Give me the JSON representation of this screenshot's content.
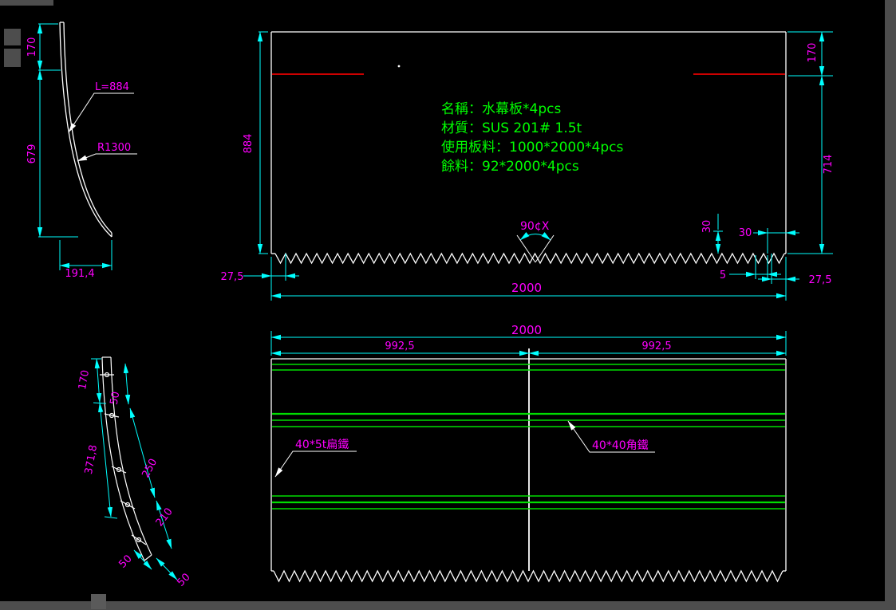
{
  "app": {
    "background": "#000000",
    "chrome_color": "#4d4d4d"
  },
  "colors": {
    "line": "#ffffff",
    "dimension": "#00ffff",
    "dim_text": "#ff00ff",
    "note_text": "#00ff00",
    "red_marker": "#cc0000",
    "green_bar": "#00dd00"
  },
  "notes": {
    "line1": "名稱：水幕板*4pcs",
    "line2": "材質：SUS 201# 1.5t",
    "line3": "使用板料：1000*2000*4pcs",
    "line4": "餘料：92*2000*4pcs"
  },
  "side_view": {
    "height_top": "170",
    "height_main": "679",
    "width_bottom": "191,4",
    "arc_length": "L=884",
    "radius": "R1300"
  },
  "front_view": {
    "height": "884",
    "height_top_right": "170",
    "height_bottom_right": "714",
    "width": "2000",
    "offset_left": "27,5",
    "offset_right": "27,5",
    "tooth_height": "30",
    "tooth_offset": "30",
    "tooth_gap": "5",
    "tooth_angle": "90¢X"
  },
  "curve_view": {
    "seg_top": "170",
    "seg_hole_top": "50",
    "seg_main": "371,8",
    "seg_mid": "250",
    "seg_low": "210",
    "seg_end_a": "50",
    "seg_end_b": "50"
  },
  "rear_view": {
    "width_total": "2000",
    "width_left": "992,5",
    "width_right": "992,5",
    "label_flat_bar": "40*5t扁鐵",
    "label_angle_bar": "40*40角鐵"
  }
}
